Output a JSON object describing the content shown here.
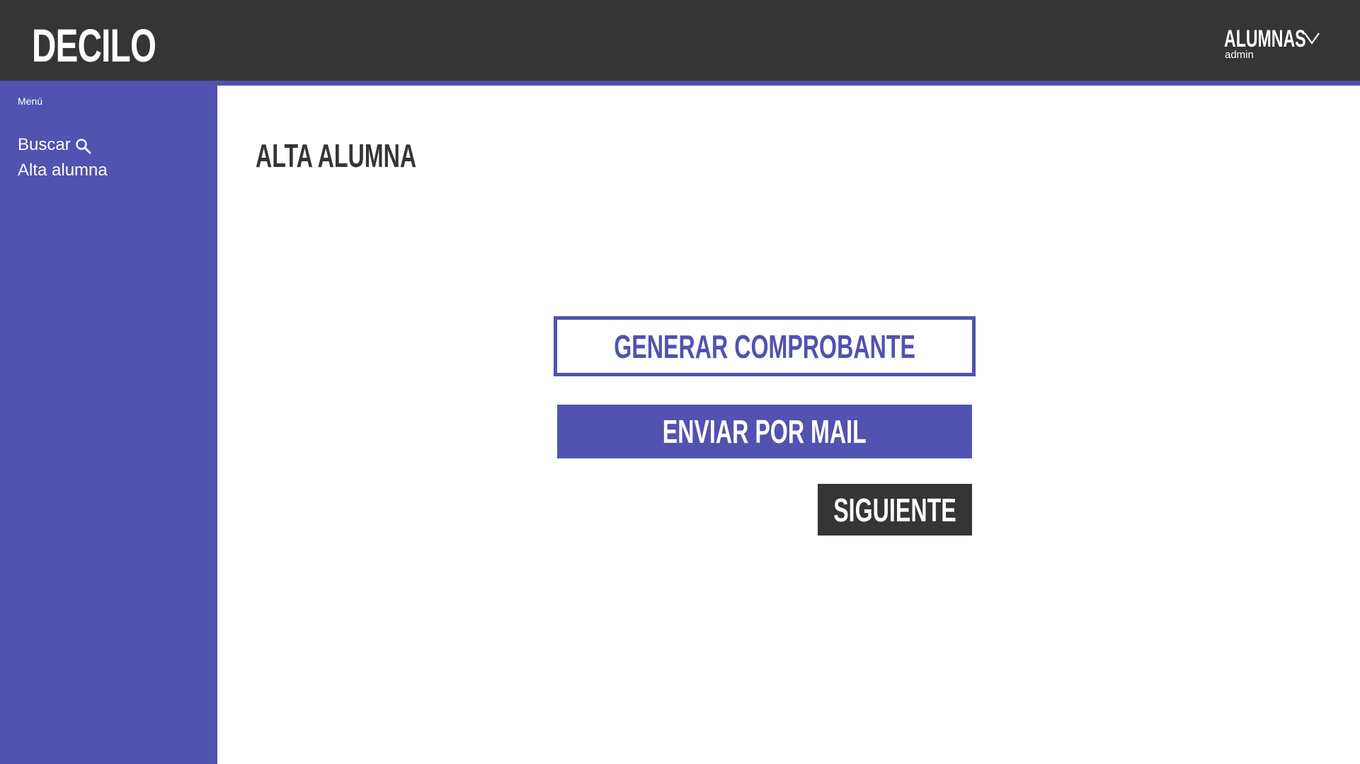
{
  "header": {
    "logo": "DECILO",
    "section": "ALUMNAS",
    "user": "admin"
  },
  "sidebar": {
    "heading": "Menú",
    "items": [
      {
        "label": "Buscar",
        "icon": "search-icon"
      },
      {
        "label": "Alta alumna"
      }
    ]
  },
  "main": {
    "title": "ALTA ALUMNA",
    "buttons": {
      "generate": "GENERAR COMPROBANTE",
      "send_mail": "ENVIAR POR MAIL",
      "next": "SIGUIENTE"
    }
  },
  "colors": {
    "dark": "#353535",
    "accent": "#5053af",
    "background": "#ffffff"
  }
}
